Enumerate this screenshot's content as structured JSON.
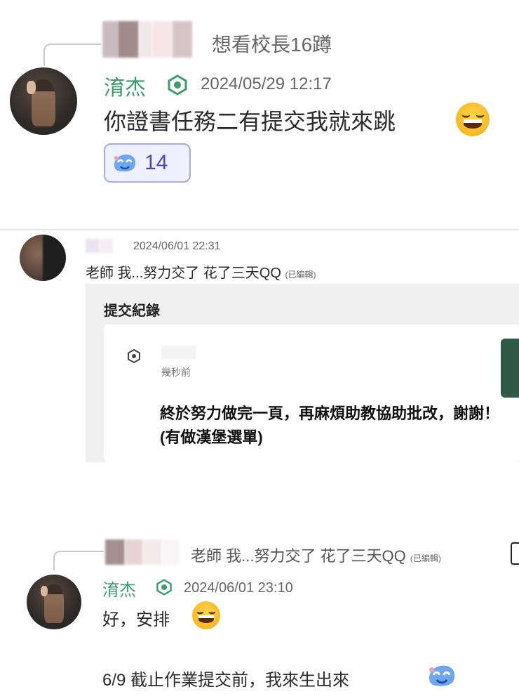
{
  "post1": {
    "quoted_text": "想看校長16蹲",
    "author": "淯杰",
    "timestamp": "2024/05/29 12:17",
    "message": "你證書任務二有提交我就來跳",
    "reaction_count": "14",
    "icons": [
      "reply-connector",
      "verified-badge-icon",
      "laugh-emoji-icon",
      "reaction-icon"
    ]
  },
  "post2": {
    "timestamp": "2024/06/01 22:31",
    "message": "老師 我...努力交了 花了三天QQ",
    "edited_tag": "(已編輯)",
    "submission_panel": {
      "title": "提交紀錄",
      "time_ago": "幾秒前",
      "content": "終於努力做完一頁，再麻煩助教協助批改，謝謝！ (有做漢堡選單)"
    }
  },
  "post3": {
    "quoted_text": "老師 我...努力交了 花了三天QQ",
    "quoted_edited_tag": "(已編輯)",
    "author": "淯杰",
    "timestamp": "2024/06/01 23:10",
    "message_line1": "好，安排",
    "message_line2": "6/9 截止作業提交前，我來生出來"
  },
  "colors": {
    "author_green": "#3c9c6e",
    "reaction_border": "#a9a7e8",
    "reaction_bg": "#eef0ff",
    "panel_gray": "#f0f0f0",
    "accent_dark_green": "#2f5b46"
  }
}
